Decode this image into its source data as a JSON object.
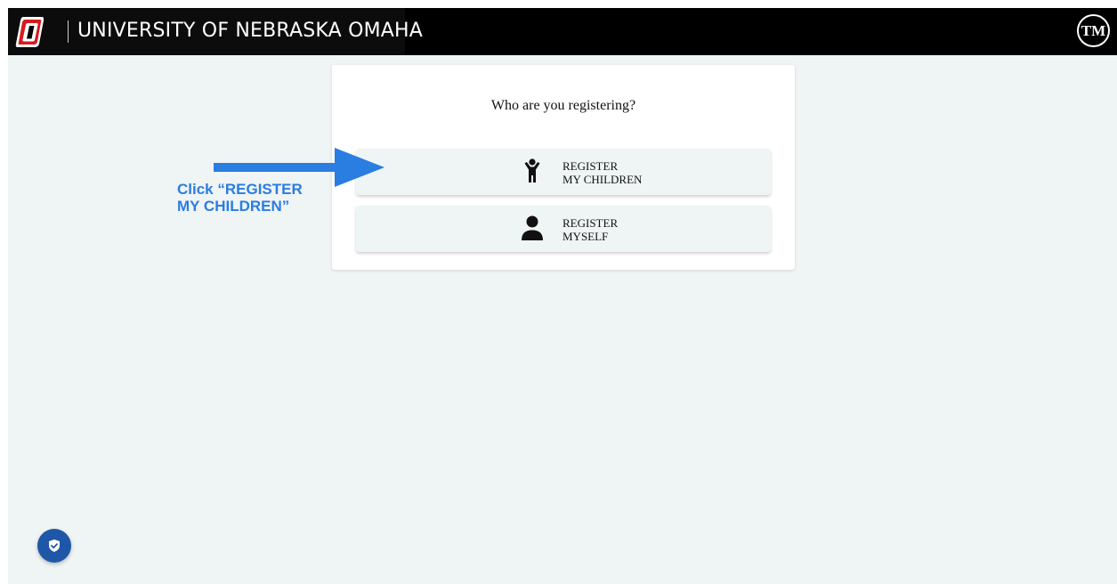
{
  "header": {
    "university_name": "UNIVERSITY OF NEBRASKA OMAHA",
    "logo_icon": "uno-o-logo-icon",
    "avatar_initials": "TM"
  },
  "registration": {
    "question": "Who are you registering?",
    "options": [
      {
        "line1": "REGISTER",
        "line2": "MY CHILDREN",
        "icon": "child-icon"
      },
      {
        "line1": "REGISTER",
        "line2": "MYSELF",
        "icon": "person-icon"
      }
    ]
  },
  "annotation": {
    "line1": "Click “REGISTER",
    "line2": "MY CHILDREN”",
    "color": "#2a7de1"
  },
  "floating": {
    "icon": "shield-check-icon",
    "color": "#1f57a8"
  }
}
